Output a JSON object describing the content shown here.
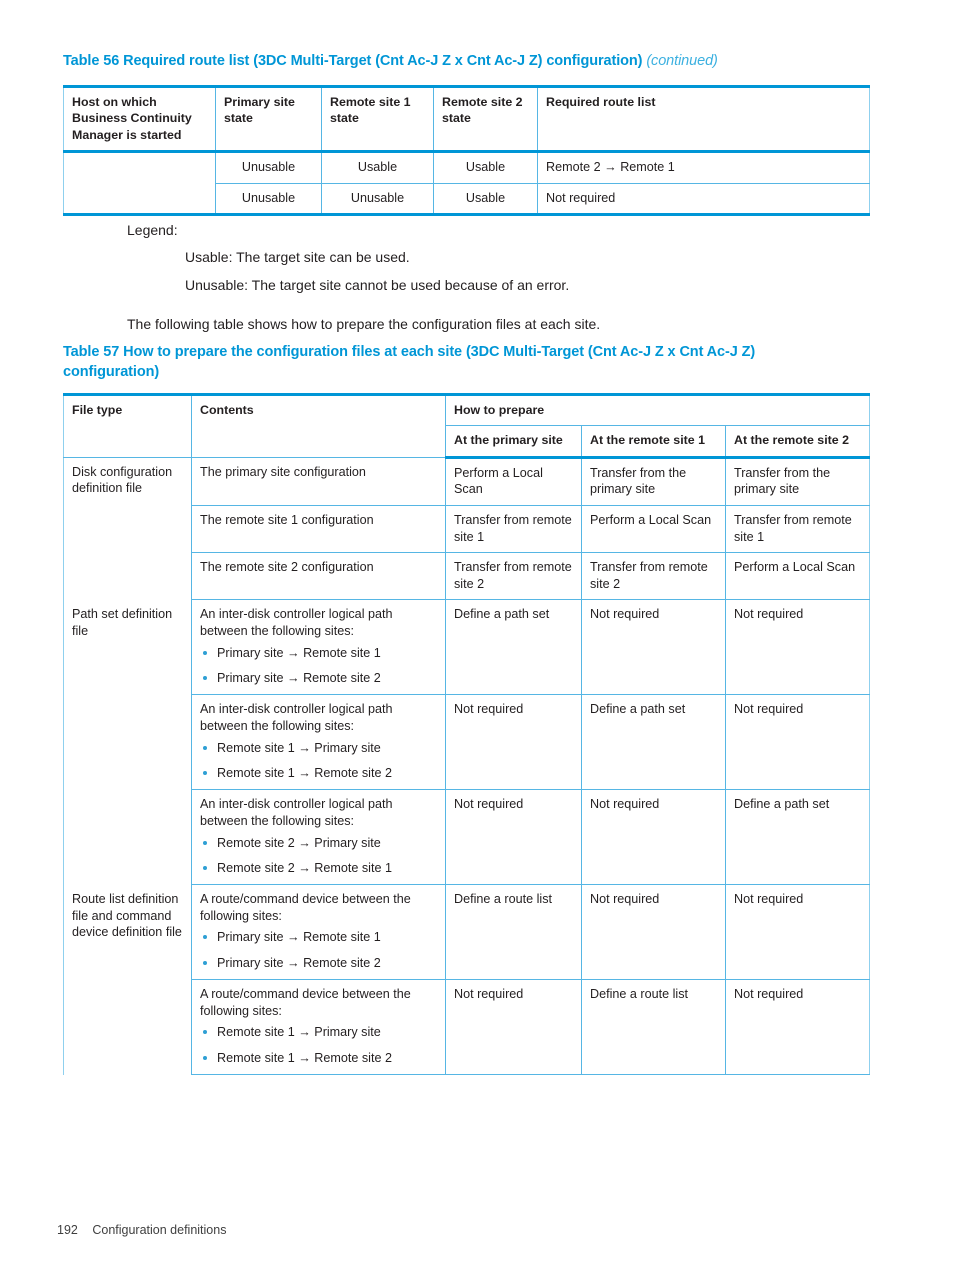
{
  "table56": {
    "caption": "Table 56 Required route list (3DC Multi-Target (Cnt Ac-J Z x Cnt Ac-J Z) configuration)",
    "caption_continued": "(continued)",
    "headers": [
      "Host on which Business Continuity Manager is started",
      "Primary site state",
      "Remote site 1 state",
      "Remote site 2 state",
      "Required route list"
    ],
    "rows": [
      {
        "host": "",
        "primary": "Unusable",
        "remote1": "Usable",
        "remote2": "Usable",
        "route": "Remote 2 → Remote 1"
      },
      {
        "host": "",
        "primary": "Unusable",
        "remote1": "Unusable",
        "remote2": "Usable",
        "route": "Not required"
      }
    ]
  },
  "legend": {
    "label": "Legend:",
    "items": [
      "Usable: The target site can be used.",
      "Unusable: The target site cannot be used because of an error."
    ]
  },
  "intro": "The following table shows how to prepare the configuration files at each site.",
  "table57": {
    "caption": "Table 57 How to prepare the configuration files at each site (3DC Multi-Target (Cnt Ac-J Z x Cnt Ac-J Z) configuration)",
    "headers": {
      "file_type": "File type",
      "contents": "Contents",
      "how_to_prepare": "How to prepare",
      "at_primary": "At the primary site",
      "at_remote1": "At the remote site 1",
      "at_remote2": "At the remote site 2"
    },
    "groups": [
      {
        "file_type": "Disk configuration definition file",
        "rows": [
          {
            "contents_text": "The primary site configuration",
            "bullets": [],
            "at_primary": "Perform a Local Scan",
            "at_remote1": "Transfer from the primary site",
            "at_remote2": "Transfer from the primary site"
          },
          {
            "contents_text": "The remote site 1 configuration",
            "bullets": [],
            "at_primary": "Transfer from remote site 1",
            "at_remote1": "Perform a Local Scan",
            "at_remote2": "Transfer from remote site 1"
          },
          {
            "contents_text": "The remote site 2 configuration",
            "bullets": [],
            "at_primary": "Transfer from remote site 2",
            "at_remote1": "Transfer from remote site 2",
            "at_remote2": "Perform a Local Scan"
          }
        ]
      },
      {
        "file_type": "Path set definition file",
        "rows": [
          {
            "contents_text": "An inter-disk controller logical path between the following sites:",
            "bullets": [
              "Primary site → Remote site 1",
              "Primary site → Remote site 2"
            ],
            "at_primary": "Define a path set",
            "at_remote1": "Not required",
            "at_remote2": "Not required"
          },
          {
            "contents_text": "An inter-disk controller logical path between the following sites:",
            "bullets": [
              "Remote site 1 → Primary site",
              "Remote site 1 → Remote site 2"
            ],
            "at_primary": "Not required",
            "at_remote1": "Define a path set",
            "at_remote2": "Not required"
          },
          {
            "contents_text": "An inter-disk controller logical path between the following sites:",
            "bullets": [
              "Remote site 2 → Primary site",
              "Remote site 2 → Remote site 1"
            ],
            "at_primary": "Not required",
            "at_remote1": "Not required",
            "at_remote2": "Define a path set"
          }
        ]
      },
      {
        "file_type": "Route list definition file and command device definition file",
        "rows": [
          {
            "contents_text": "A route/command device between the following sites:",
            "bullets": [
              "Primary site → Remote site 1",
              "Primary site → Remote site 2"
            ],
            "at_primary": "Define a route list",
            "at_remote1": "Not required",
            "at_remote2": "Not required"
          },
          {
            "contents_text": "A route/command device between the following sites:",
            "bullets": [
              "Remote site 1 → Primary site",
              "Remote site 1 → Remote site 2"
            ],
            "at_primary": "Not required",
            "at_remote1": "Define a route list",
            "at_remote2": "Not required"
          }
        ]
      }
    ]
  },
  "footer": {
    "page_number": "192",
    "section": "Configuration definitions"
  },
  "colors": {
    "accent": "#0096d6",
    "rule": "#56b6e4",
    "bullet": "#2e9fd4",
    "text": "#231f20"
  }
}
